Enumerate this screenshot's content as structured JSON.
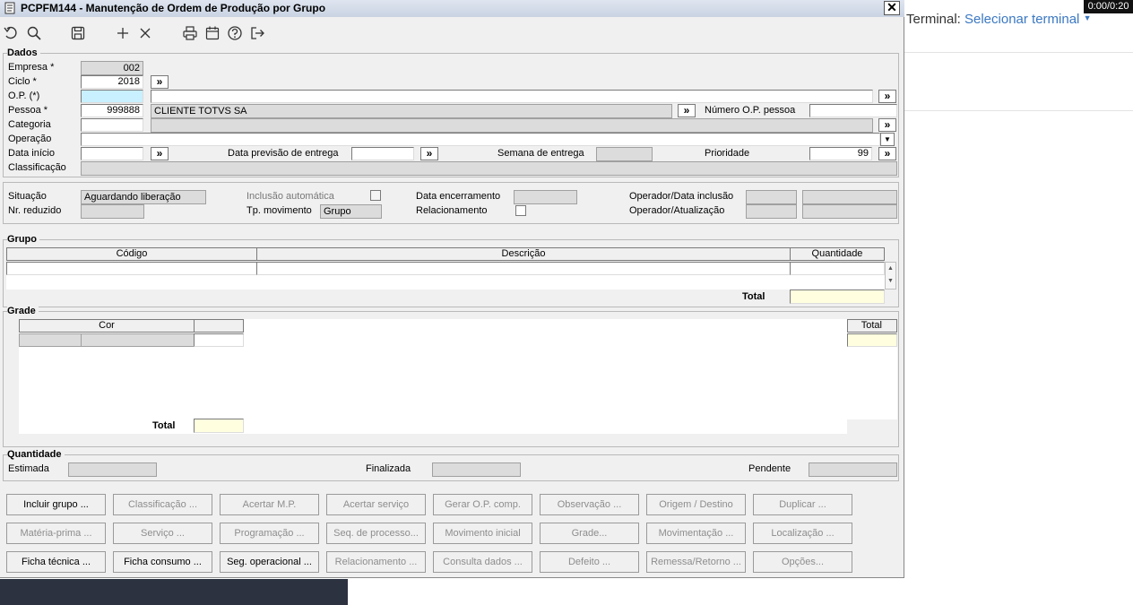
{
  "window": {
    "title": "PCPFM144 - Manutenção de Ordem de Produção por Grupo",
    "close": "✕"
  },
  "terminal": {
    "label": "Terminal:",
    "link": "Selecionar terminal",
    "timer": "0:00/0:20"
  },
  "dados": {
    "section": "Dados",
    "empresa_label": "Empresa *",
    "empresa_value": "002",
    "ciclo_label": "Ciclo *",
    "ciclo_value": "2018",
    "op_label": "O.P. (*)",
    "pessoa_label": "Pessoa *",
    "pessoa_value": "999888",
    "pessoa_name": "CLIENTE TOTVS SA",
    "numero_op_label": "Número O.P. pessoa",
    "categoria_label": "Categoria",
    "operacao_label": "Operação",
    "data_inicio_label": "Data início",
    "data_prev_label": "Data previsão de entrega",
    "semana_label": "Semana de entrega",
    "prioridade_label": "Prioridade",
    "prioridade_value": "99",
    "classificacao_label": "Classificação",
    "chev": "»"
  },
  "status": {
    "situacao_label": "Situação",
    "situacao_value": "Aguardando liberação",
    "nr_reduzido_label": "Nr. reduzido",
    "inclusao_label": "Inclusão automática",
    "tp_mov_label": "Tp. movimento",
    "tp_mov_value": "Grupo",
    "data_enc_label": "Data encerramento",
    "relacionamento_label": "Relacionamento",
    "op_inclusao_label": "Operador/Data inclusão",
    "op_atual_label": "Operador/Atualização"
  },
  "grupo": {
    "section": "Grupo",
    "columns": [
      "Código",
      "Descrição",
      "Quantidade"
    ],
    "total_label": "Total"
  },
  "grade": {
    "section": "Grade",
    "col_cor": "Cor",
    "col_total": "Total",
    "total_label": "Total"
  },
  "quantidade": {
    "section": "Quantidade",
    "estimada_label": "Estimada",
    "finalizada_label": "Finalizada",
    "pendente_label": "Pendente"
  },
  "buttons": [
    [
      {
        "label": "Incluir grupo ...",
        "enabled": true
      },
      {
        "label": "Classificação ...",
        "enabled": false
      },
      {
        "label": "Acertar M.P.",
        "enabled": false
      },
      {
        "label": "Acertar serviço",
        "enabled": false
      },
      {
        "label": "Gerar O.P. comp.",
        "enabled": false
      },
      {
        "label": "Observação ...",
        "enabled": false
      },
      {
        "label": "Origem / Destino",
        "enabled": false
      },
      {
        "label": "Duplicar ...",
        "enabled": false
      }
    ],
    [
      {
        "label": "Matéria-prima ...",
        "enabled": false
      },
      {
        "label": "Serviço ...",
        "enabled": false
      },
      {
        "label": "Programação ...",
        "enabled": false
      },
      {
        "label": "Seq. de processo...",
        "enabled": false
      },
      {
        "label": "Movimento inicial",
        "enabled": false
      },
      {
        "label": "Grade...",
        "enabled": false
      },
      {
        "label": "Movimentação ...",
        "enabled": false
      },
      {
        "label": "Localização ...",
        "enabled": false
      }
    ],
    [
      {
        "label": "Ficha técnica ...",
        "enabled": true
      },
      {
        "label": "Ficha consumo ...",
        "enabled": true
      },
      {
        "label": "Seg. operacional ...",
        "enabled": true
      },
      {
        "label": "Relacionamento ...",
        "enabled": false
      },
      {
        "label": "Consulta dados ...",
        "enabled": false
      },
      {
        "label": "Defeito ...",
        "enabled": false
      },
      {
        "label": "Remessa/Retorno ...",
        "enabled": false
      },
      {
        "label": "Opções...",
        "enabled": false
      }
    ]
  ]
}
